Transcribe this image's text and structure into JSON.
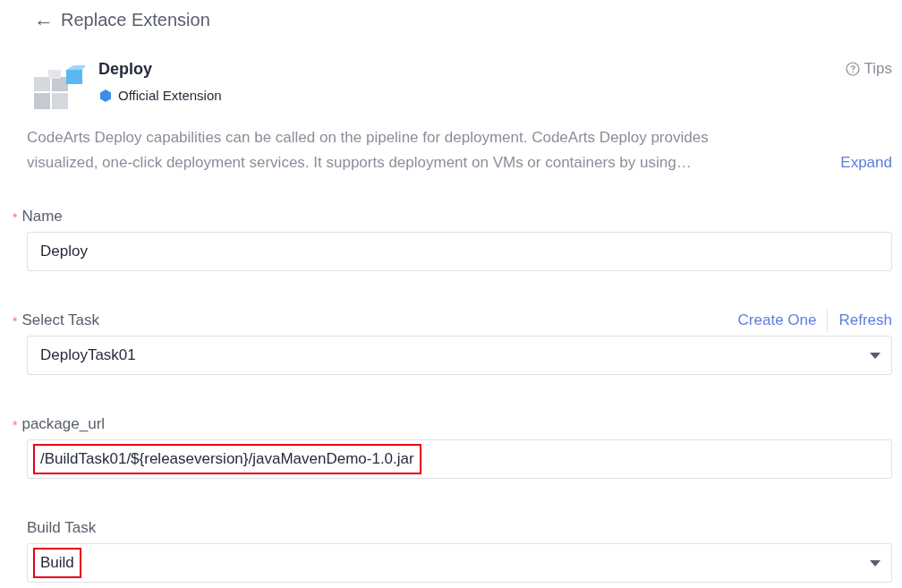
{
  "header": {
    "back_icon": "←",
    "title": "Replace Extension"
  },
  "extension": {
    "name": "Deploy",
    "badge": "Official Extension",
    "tips": "Tips",
    "description_lines": [
      "CodeArts Deploy capabilities can be called on the pipeline for deployment. CodeArts Deploy provides",
      "visualized, one-click deployment services. It supports deployment on VMs or containers by using…"
    ],
    "expand": "Expand"
  },
  "fields": [
    {
      "kind": "input",
      "required_mark": "*",
      "label": "Name",
      "value": "Deploy",
      "highlighted": false
    },
    {
      "kind": "select",
      "required_mark": "*",
      "label": "Select Task",
      "value": "DeployTask01",
      "highlighted": false,
      "links": [
        "Create One",
        "Refresh"
      ]
    },
    {
      "kind": "input",
      "required_mark": "*",
      "label": "package_url",
      "value": "/BuildTask01/${releaseversion}/javaMavenDemo-1.0.jar",
      "highlighted": true
    },
    {
      "kind": "select",
      "label": "Build Task",
      "value": "Build",
      "highlighted": true
    }
  ]
}
